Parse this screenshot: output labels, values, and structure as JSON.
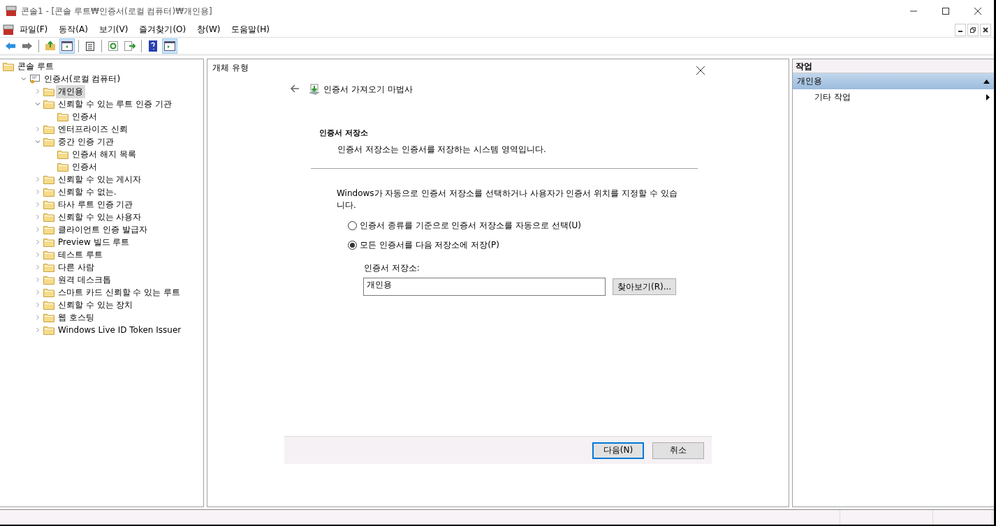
{
  "window": {
    "title": "콘솔1 - [콘솔 루트₩인증서(로컬 컴퓨터)₩개인용]"
  },
  "menu": [
    "파일(F)",
    "동작(A)",
    "보기(V)",
    "즐겨찾기(O)",
    "창(W)",
    "도움말(H)"
  ],
  "toolbar": [
    {
      "kind": "back",
      "pressed": false
    },
    {
      "kind": "forward",
      "pressed": false
    },
    {
      "kind": "sep"
    },
    {
      "kind": "up",
      "pressed": false
    },
    {
      "kind": "tree",
      "pressed": true
    },
    {
      "kind": "sep"
    },
    {
      "kind": "props",
      "pressed": false
    },
    {
      "kind": "sep"
    },
    {
      "kind": "refresh",
      "pressed": false
    },
    {
      "kind": "export",
      "pressed": false
    },
    {
      "kind": "sep"
    },
    {
      "kind": "help",
      "pressed": false
    },
    {
      "kind": "actions",
      "pressed": true
    }
  ],
  "tree": [
    {
      "label": "콘솔 루트",
      "kind": "root",
      "selected": false,
      "children": [
        {
          "label": "인증서(로컬 컴퓨터)",
          "kind": "cert",
          "selected": false,
          "expanded": true,
          "children": [
            {
              "label": "개인용",
              "selected": true,
              "expanded": false
            },
            {
              "label": "신뢰할 수 있는 루트 인증 기관",
              "selected": false,
              "expanded": true,
              "children": [
                {
                  "label": "인증서",
                  "selected": false
                }
              ]
            },
            {
              "label": "엔터프라이즈 신뢰",
              "selected": false,
              "expanded": false
            },
            {
              "label": "중간 인증 기관",
              "selected": false,
              "expanded": true,
              "children": [
                {
                  "label": "인증서 해지 목록",
                  "selected": false
                },
                {
                  "label": "인증서",
                  "selected": false
                }
              ]
            },
            {
              "label": "신뢰할 수 있는 게시자",
              "selected": false,
              "expanded": false
            },
            {
              "label": "신뢰할 수 없는.",
              "selected": false,
              "expanded": false
            },
            {
              "label": "타사 루트 인증 기관",
              "selected": false,
              "expanded": false
            },
            {
              "label": "신뢰할 수 있는 사용자",
              "selected": false,
              "expanded": false
            },
            {
              "label": "클라이언트 인증 발급자",
              "selected": false,
              "expanded": false
            },
            {
              "label": "Preview 빌드 루트",
              "selected": false,
              "expanded": false
            },
            {
              "label": "테스트 루트",
              "selected": false,
              "expanded": false
            },
            {
              "label": "다른 사람",
              "selected": false,
              "expanded": false
            },
            {
              "label": "원격 데스크톱",
              "selected": false,
              "expanded": false
            },
            {
              "label": "스마트 카드 신뢰할 수 있는 루트",
              "selected": false,
              "expanded": false
            },
            {
              "label": "신뢰할 수 있는 장치",
              "selected": false,
              "expanded": false
            },
            {
              "label": "웹 호스팅",
              "selected": false,
              "expanded": false
            },
            {
              "label": "Windows Live ID Token Issuer",
              "selected": false,
              "expanded": false
            }
          ]
        }
      ]
    }
  ],
  "content": {
    "column_header": "개체 유형"
  },
  "wizard": {
    "title": "인증서 가져오기 마법사",
    "heading": "인증서 저장소",
    "subtitle": "인증서 저장소는 인증서를 저장하는 시스템 영역입니다.",
    "description": "Windows가 자동으로 인증서 저장소를 선택하거나 사용자가 인증서 위치를 지정할 수 있습니다.",
    "options": [
      {
        "label": "인증서 종류를 기준으로 인증서 저장소를 자동으로 선택(U)",
        "selected": false
      },
      {
        "label": "모든 인증서를 다음 저장소에 저장(P)",
        "selected": true
      }
    ],
    "store_label": "인증서 저장소:",
    "store_value": "개인용",
    "browse": "찾아보기(R)...",
    "buttons": [
      {
        "label": "다음(N)",
        "default": true
      },
      {
        "label": "취소",
        "default": false
      }
    ]
  },
  "actions": {
    "title": "작업",
    "groups": [
      {
        "label": "개인용",
        "expanded": true,
        "items": [
          {
            "label": "기타 작업"
          }
        ]
      }
    ]
  }
}
